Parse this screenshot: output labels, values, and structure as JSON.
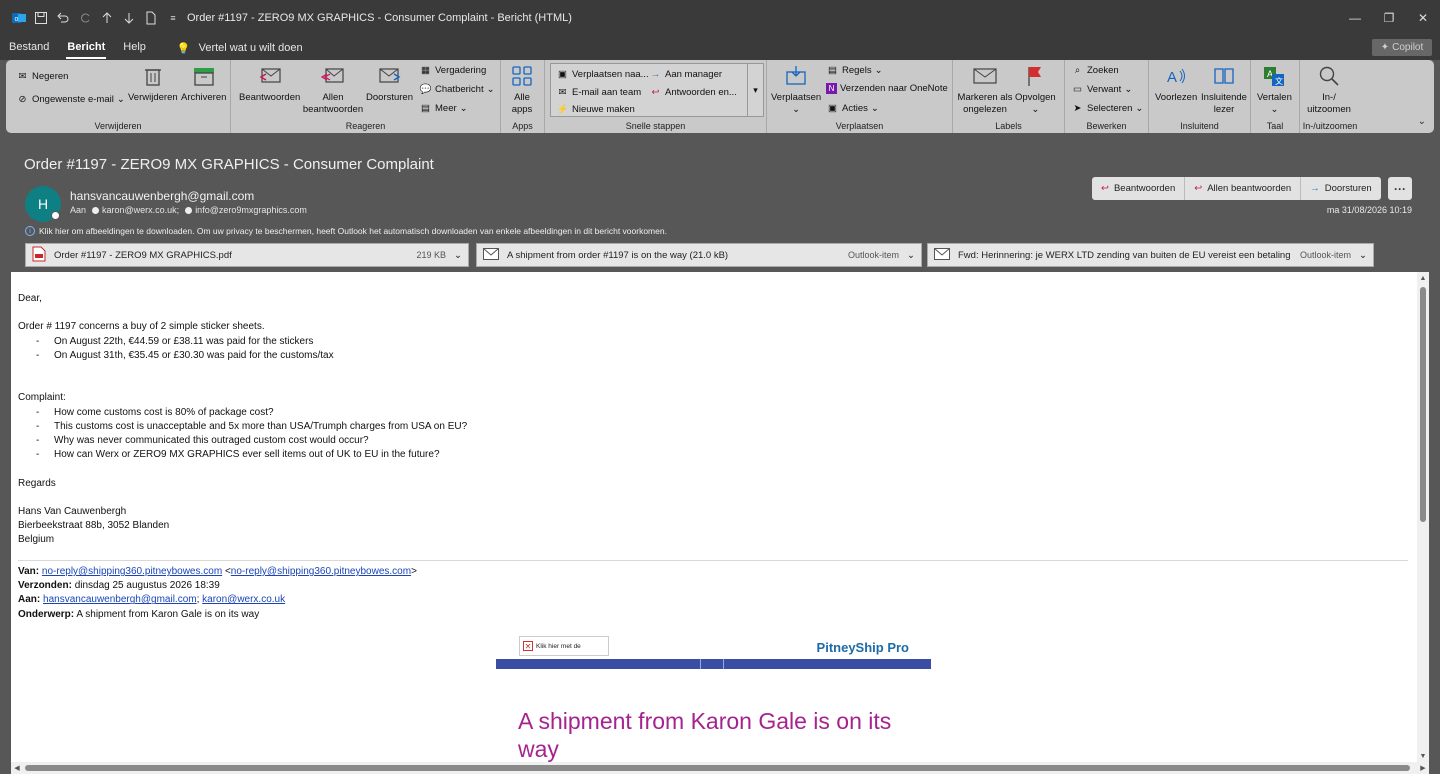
{
  "window": {
    "title": "Order #1197 - ZERO9 MX GRAPHICS - Consumer Complaint  -  Bericht (HTML)"
  },
  "menu": {
    "tabs": [
      "Bestand",
      "Bericht",
      "Help"
    ],
    "tell_me": "Vertel wat u wilt doen",
    "copilot": "Copilot"
  },
  "ribbon": {
    "verwijderen": {
      "ignore": "Negeren",
      "junk": "Ongewenste e-mail",
      "delete": "Verwijderen",
      "archive": "Archiveren",
      "label": "Verwijderen"
    },
    "reageren": {
      "reply": "Beantwoorden",
      "reply_all": "Allen beantwoorden",
      "forward": "Doorsturen",
      "meeting": "Vergadering",
      "chat": "Chatbericht",
      "more": "Meer",
      "label": "Reageren"
    },
    "apps": {
      "all_apps": "Alle apps",
      "label": "Apps"
    },
    "quick": {
      "move_to": "Verplaatsen naa...",
      "to_manager": "Aan manager",
      "team_email": "E-mail aan team",
      "reply_delete": "Antwoorden en...",
      "new_message": "Nieuwe maken",
      "label": "Snelle stappen"
    },
    "verplaatsen": {
      "move": "Verplaatsen",
      "rules": "Regels",
      "onenote": "Verzenden naar OneNote",
      "actions": "Acties",
      "label": "Verplaatsen"
    },
    "labels": {
      "mark_unread": "Markeren als ongelezen",
      "follow_up": "Opvolgen",
      "label": "Labels"
    },
    "bewerken": {
      "find": "Zoeken",
      "related": "Verwant",
      "select": "Selecteren",
      "label": "Bewerken"
    },
    "insluitend": {
      "read_aloud": "Voorlezen",
      "immersive": "Insluitende lezer",
      "label": "Insluitend"
    },
    "taal": {
      "translate": "Vertalen",
      "label": "Taal"
    },
    "zoom": {
      "zoom": "In-/ uitzoomen",
      "label": "In-/uitzoomen"
    }
  },
  "message": {
    "subject": "Order #1197 - ZERO9 MX GRAPHICS - Consumer Complaint",
    "avatar_initial": "H",
    "sender": "hansvancauwenbergh@gmail.com",
    "to_label": "Aan",
    "recipients": [
      "karon@werx.co.uk;",
      "info@zero9mxgraphics.com"
    ],
    "date": "ma 31/08/2026 10:19",
    "actions": {
      "reply": "Beantwoorden",
      "reply_all": "Allen beantwoorden",
      "forward": "Doorsturen"
    },
    "info_bar": "Klik hier om afbeeldingen te downloaden. Om uw privacy te beschermen, heeft Outlook het automatisch downloaden van enkele afbeeldingen in dit bericht voorkomen.",
    "attachments": [
      {
        "name": "Order #1197 - ZERO9 MX GRAPHICS.pdf",
        "meta": "219 KB",
        "icon": "pdf-icon"
      },
      {
        "name": "A shipment from order #1197 is on the way (21.0 kB)",
        "meta": "Outlook-item",
        "icon": "mail-icon"
      },
      {
        "name": "Fwd: Herinnering: je WERX LTD zending van buiten de EU vereist een betaling (65.6 kB)",
        "meta": "Outlook-item",
        "icon": "mail-icon"
      }
    ]
  },
  "body": {
    "greeting": "Dear,",
    "intro": "Order # 1197 concerns a buy of 2 simple sticker sheets.",
    "payments": [
      "On August 22th, €44.59 or £38.11 was paid for the stickers",
      "On August 31th, €35.45 or £30.30 was paid for the customs/tax"
    ],
    "complaint_label": "Complaint:",
    "complaints": [
      "How come customs cost is 80% of package cost?",
      "This customs cost is unacceptable and 5x more than USA/Trumph charges from USA on EU?",
      "Why was never communicated this outraged custom cost would occur?",
      "How can Werx or ZERO9 MX GRAPHICS ever sell items out of UK to EU in the future?"
    ],
    "regards": "Regards",
    "sig_name": "Hans Van Cauwenbergh",
    "sig_address": "Bierbeekstraat 88b, 3052 Blanden",
    "sig_country": "Belgium",
    "fwd": {
      "from_label": "Van:",
      "from_link": "no-reply@shipping360.pitneybowes.com",
      "from_bracket": "no-reply@shipping360.pitneybowes.com",
      "sent_label": "Verzonden:",
      "sent_value": "dinsdag 25 augustus 2026 18:39",
      "to_label": "Aan:",
      "to_link1": "hansvancauwenbergh@gmail.com",
      "to_link2": "karon@werx.co.uk",
      "subject_label": "Onderwerp:",
      "subject_value": "A shipment from Karon Gale is on its way"
    },
    "embed": {
      "broken_image": "Klik hier met de",
      "brand": "PitneyShip Pro",
      "headline": "A shipment from Karon Gale is on its way"
    }
  }
}
